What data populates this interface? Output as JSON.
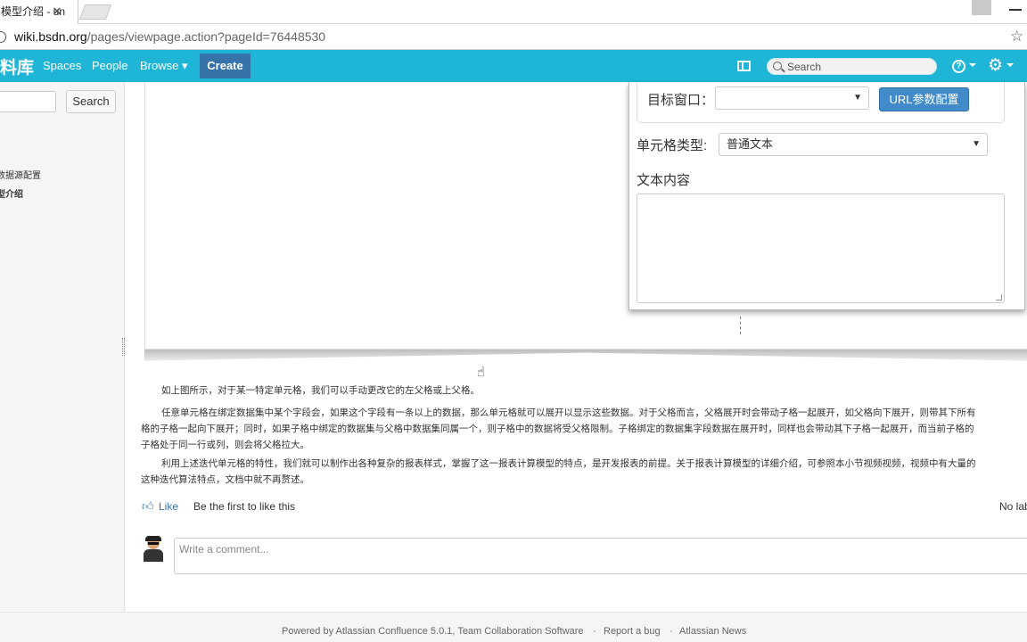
{
  "browser": {
    "tab_title": "模型介绍 - un",
    "tab_close": "✕",
    "url_host": "wiki.bsdn.org",
    "url_path": "/pages/viewpage.action?pageId=76448530"
  },
  "header": {
    "logo": "料库",
    "nav": {
      "spaces": "Spaces",
      "people": "People",
      "browse": "Browse"
    },
    "create": "Create",
    "search_placeholder": "Search",
    "help": "?"
  },
  "sidebar": {
    "search_button": "Search",
    "items": [
      "数据源配置",
      "型介绍"
    ]
  },
  "panel": {
    "target_window_label": "目标窗口：",
    "target_window_value": "",
    "url_param_button": "URL参数配置",
    "cell_type_label": "单元格类型:",
    "cell_type_value": "普通文本",
    "text_content_label": "文本内容",
    "text_content_value": ""
  },
  "article": {
    "p1": "如上图所示，对于某一特定单元格，我们可以手动更改它的左父格或上父格。",
    "p2_line1": "任意单元格在绑定数据集中某个字段会，如果这个字段有一条以上的数据，那么单元格就可以展开以显示这些数据。对于父格而言，父格展开时会带动子格一起展开，如父格向下展开，则带其下所有",
    "p2_line2": "格的子格一起向下展开；同时，如果子格中绑定的数据集与父格中数据集同属一个，则子格中的数据将受父格限制。子格绑定的数据集字段数据在展开时，同样也会带动其下子格一起展开，而当前子格的",
    "p2_line3": "子格处于同一行或列，则会将父格拉大。",
    "p3_line1": "利用上述迭代单元格的特性，我们就可以制作出各种复杂的报表样式，掌握了这一报表计算模型的特点，是开发报表的前提。关于报表计算模型的详细介绍，可参照本小节视频视频，视频中有大量的",
    "p3_line2": "这种迭代算法特点，文档中就不再赘述。"
  },
  "social": {
    "like": "Like",
    "like_note": "Be the first to like this",
    "labels": "No lab"
  },
  "comment": {
    "placeholder": "Write a comment..."
  },
  "footer": {
    "powered_by": "Powered by Atlassian Confluence 5.0.1, Team Collaboration Software",
    "sep": "·",
    "report_bug": "Report a bug",
    "news": "Atlassian News"
  }
}
